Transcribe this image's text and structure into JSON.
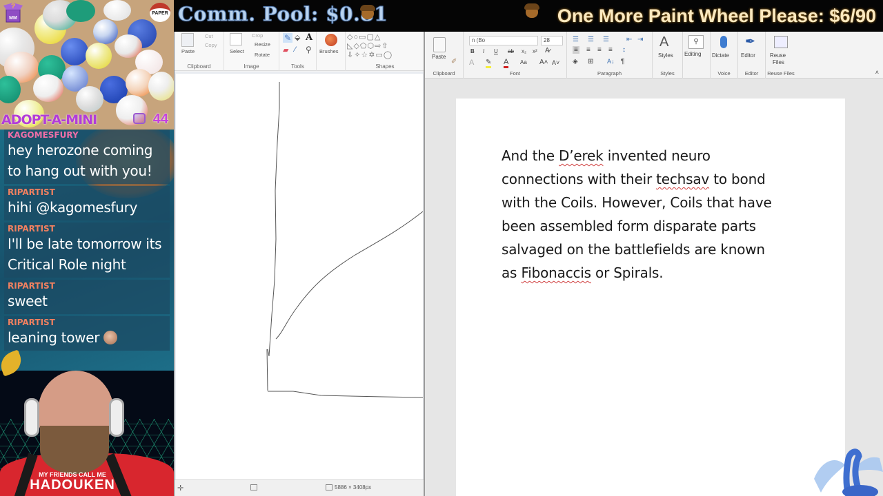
{
  "overlay": {
    "community_pool": "Comm. Pool: $0.81",
    "goal": "One More Paint Wheel Please: $6/90",
    "adopt_label": "ADOPT-A-MINI",
    "adopt_count": "44",
    "paper_badge": "PAPER",
    "colors": {
      "pool_text": "#b9d3ef",
      "goal_text": "#fbe9c0",
      "adopt": "#b23cd8",
      "chat_bg": "#1b6d86"
    }
  },
  "chat": {
    "messages": [
      {
        "user": "KAGOMESFURY",
        "user_color": "#f06fa8",
        "text": "hey herozone coming to hang out with you!"
      },
      {
        "user": "RIPARTIST",
        "user_color": "#f08060",
        "text": "hihi @kagomesfury"
      },
      {
        "user": "RIPARTIST",
        "user_color": "#f08060",
        "text": "I'll be late tomorrow its Critical Role night"
      },
      {
        "user": "RIPARTIST",
        "user_color": "#f08060",
        "text": "sweet"
      },
      {
        "user": "RIPARTIST",
        "user_color": "#f08060",
        "text": "leaning tower",
        "emote": "face-emote"
      }
    ]
  },
  "webcam": {
    "shirt_line1": "MY FRIENDS CALL ME",
    "shirt_line2": "HADOUKEN"
  },
  "paint": {
    "groups": {
      "clipboard": {
        "label": "Clipboard",
        "paste": "Paste",
        "cut": "Cut",
        "copy": "Copy"
      },
      "image": {
        "label": "Image",
        "select": "Select",
        "crop": "Crop",
        "resize": "Resize",
        "rotate": "Rotate"
      },
      "tools": {
        "label": "Tools"
      },
      "brushes": {
        "label": "Brushes"
      },
      "shapes": {
        "label": "Shapes"
      }
    },
    "status": {
      "canvas_size": "5886 × 3408px"
    }
  },
  "word": {
    "ribbon": {
      "clipboard": {
        "label": "Clipboard",
        "paste": "Paste"
      },
      "font": {
        "label": "Font",
        "font_name": "n (Bo",
        "font_size": "28"
      },
      "paragraph": {
        "label": "Paragraph"
      },
      "styles": {
        "label": "Styles",
        "button": "Styles"
      },
      "editing": {
        "button": "Editing"
      },
      "voice": {
        "label": "Voice",
        "button": "Dictate"
      },
      "editor": {
        "label": "Editor",
        "button": "Editor"
      },
      "reuse": {
        "label": "Reuse Files",
        "button_line1": "Reuse",
        "button_line2": "Files"
      }
    },
    "document": {
      "lines": [
        [
          {
            "t": "And the "
          },
          {
            "t": "D’erek",
            "spell": true
          },
          {
            "t": " invented neuro"
          }
        ],
        [
          {
            "t": "connections with their "
          },
          {
            "t": "techsav",
            "spell": true
          },
          {
            "t": " to bond"
          }
        ],
        [
          {
            "t": "with the Coils. However, Coils that have"
          }
        ],
        [
          {
            "t": "been assembled form disparate parts"
          }
        ],
        [
          {
            "t": "salvaged on the battlefields are known"
          }
        ],
        [
          {
            "t": "as "
          },
          {
            "t": "Fibonaccis",
            "spell": true
          },
          {
            "t": " or Spirals."
          }
        ]
      ]
    }
  }
}
